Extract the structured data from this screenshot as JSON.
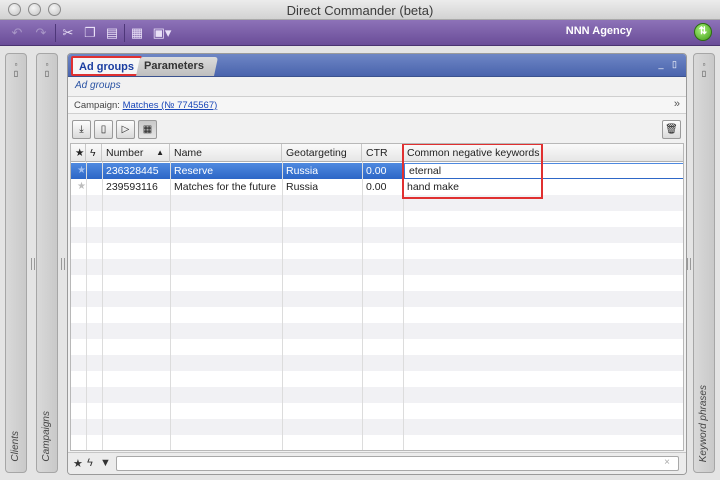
{
  "window": {
    "title": "Direct Commander (beta)"
  },
  "toolbar": {
    "agency": "NNN Agency"
  },
  "side": {
    "clients": "Clients",
    "campaigns": "Campaigns",
    "keywords": "Keyword phrases"
  },
  "tabs": [
    {
      "label": "Ad groups"
    },
    {
      "label": "Parameters"
    }
  ],
  "breadcrumb": "Ad groups",
  "campaign": {
    "label": "Campaign:",
    "link": "Matches (№ 7745567)"
  },
  "grid": {
    "columns": [
      "Number",
      "Name",
      "Geotargeting",
      "CTR",
      "Common negative keywords"
    ],
    "sort_indicator": "▲",
    "rows": [
      {
        "number": "236328445",
        "name": "Reserve",
        "geo": "Russia",
        "ctr": "0.00",
        "negative": "eternal"
      },
      {
        "number": "239593116",
        "name": "Matches for the future",
        "geo": "Russia",
        "ctr": "0.00",
        "negative": "hand make"
      }
    ]
  },
  "filter": {
    "value": "",
    "clear": "×"
  }
}
